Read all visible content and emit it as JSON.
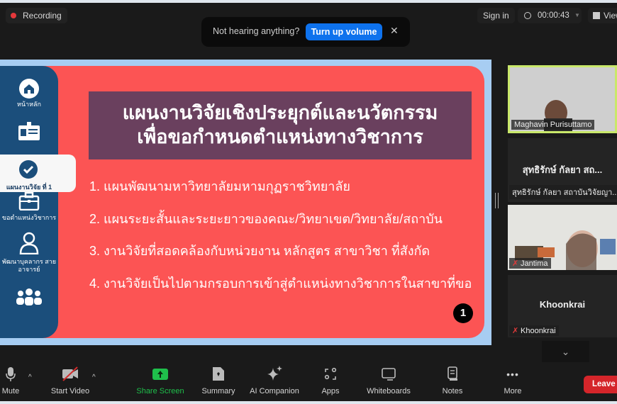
{
  "recording": {
    "label": "Recording",
    "color": "#e5383b"
  },
  "notification": {
    "message": "Not hearing anything?",
    "action_label": "Turn up volume",
    "close_icon": "close-icon"
  },
  "header": {
    "sign_in_label": "Sign in",
    "timer": "00:00:43",
    "view_label": "View"
  },
  "slide": {
    "sidebar": [
      {
        "icon": "home-icon",
        "label": "หน้าหลัก"
      },
      {
        "icon": "id-card-icon",
        "label": ""
      },
      {
        "icon": "check-circle-icon",
        "label": "แผนงานวิจัย ที่ 1",
        "active": true
      },
      {
        "icon": "briefcase-icon",
        "label": "ขอตำแหน่งวิชาการ"
      },
      {
        "icon": "person-icon",
        "label": "พัฒนาบุคลากร สายอาจารย์"
      },
      {
        "icon": "group-icon",
        "label": ""
      }
    ],
    "title_line1": "แผนงานวิจัยเชิงประยุกต์และนวัตกรรม",
    "title_line2": "เพื่อขอกำหนดตำแหน่งทางวิชาการ",
    "items": [
      "1. แผนพัฒนามหาวิทยาลัยมหามกุฏราชวิทยาลัย",
      "2. แผนระยะสั้นและระยะยาวของคณะ/วิทยาเขต/วิทยาลัย/สถาบัน",
      "3. งานวิจัยที่สอดคล้องกับหน่วยงาน หลักสูตร สาขาวิชา ที่สังกัด",
      "4. งานวิจัยเป็นไปตามกรอบการเข้าสู่ตำแหน่งทางวิชาการในสาขาที่ขอ"
    ],
    "page_badge": "1",
    "colors": {
      "frame": "#a7cdf2",
      "panel": "#fc5454",
      "sidebar": "#1b4e7b",
      "title_bg": "#6a405e"
    }
  },
  "participants": [
    {
      "name": "Maghavin Purisuttamo",
      "video": true,
      "active_speaker": true
    },
    {
      "name": "สุทธิรักษ์ กัลยา สถาบันวิจัยญา...",
      "display_name": "สุทธิรักษ์ กัลยา สถ...",
      "video": false
    },
    {
      "name": "Jantima",
      "video": true,
      "muted": true
    },
    {
      "name": "Khoonkrai",
      "display_name": "Khoonkrai",
      "video": false,
      "muted": true
    }
  ],
  "toolbar": {
    "mute": "Mute",
    "start_video": "Start Video",
    "share_screen": "Share Screen",
    "summary": "Summary",
    "ai_companion": "AI Companion",
    "apps": "Apps",
    "whiteboards": "Whiteboards",
    "notes": "Notes",
    "more": "More",
    "leave": "Leave",
    "share_color": "#1fbf4b",
    "leave_color": "#d5252a"
  }
}
